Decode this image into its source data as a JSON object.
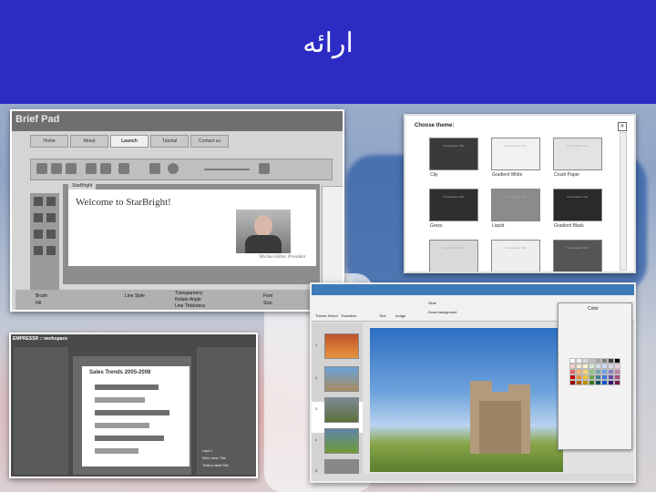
{
  "slide": {
    "title": "ارائه"
  },
  "shot1": {
    "logo": "Brief Pad",
    "nav": [
      "Home",
      "About",
      "Launch",
      "Tutorial",
      "Contact us"
    ],
    "active_nav": "Launch",
    "canvas_tab": "StarBright",
    "welcome": "Welcome to StarBright!",
    "caption": "Michael Hiller, President",
    "bottom_labels": [
      "Brush",
      "Fill",
      "Line Style",
      "Transparency",
      "Rotate Angle",
      "Line Thickness",
      "Font",
      "Size"
    ]
  },
  "shot2": {
    "title": "Choose theme:",
    "close": "✕",
    "themes": [
      {
        "name": "City",
        "color": "#3a3a3a"
      },
      {
        "name": "Gradient White",
        "color": "#f1f1f1"
      },
      {
        "name": "Crush Paper",
        "color": "#e3e3e3"
      },
      {
        "name": "Grass",
        "color": "#2f2f2f"
      },
      {
        "name": "Liquid",
        "color": "#8b8b8b"
      },
      {
        "name": "Gradient Black",
        "color": "#2a2a2a"
      },
      {
        "name": "",
        "color": "#d9d9d9"
      },
      {
        "name": "",
        "color": "#eeeeee"
      },
      {
        "name": "",
        "color": "#555555"
      }
    ],
    "theme_sample_text": "Presentation Title"
  },
  "shot3": {
    "app_title": "EMPRESSR :: workspace",
    "chart_title": "Sales Trends 2005-2008",
    "panel_rows": [
      "Layer 1",
      "Slide name: Title",
      "Textbox tablet Title"
    ]
  },
  "shot4": {
    "ribbon_labels": [
      "Theme Select",
      "Transition",
      "Text",
      "Image",
      "Slide",
      "Draw background"
    ],
    "thumb_numbers": [
      "1",
      "2",
      "3",
      "4",
      "5"
    ],
    "color_panel_title": "Color",
    "swatches": [
      "#ffffff",
      "#f2f2f2",
      "#d9d9d9",
      "#bfbfbf",
      "#a6a6a6",
      "#808080",
      "#404040",
      "#000000",
      "#f4cccc",
      "#fce5cd",
      "#fff2cc",
      "#d9ead3",
      "#d0e0e3",
      "#c9daf8",
      "#d9d2e9",
      "#ead1dc",
      "#e06666",
      "#f6b26b",
      "#ffd966",
      "#93c47d",
      "#76a5af",
      "#6d9eeb",
      "#8e7cc3",
      "#c27ba0",
      "#cc0000",
      "#e69138",
      "#f1c232",
      "#6aa84f",
      "#45818e",
      "#3c78d8",
      "#674ea7",
      "#a64d79",
      "#990000",
      "#b45f06",
      "#bf9000",
      "#38761d",
      "#134f5c",
      "#1155cc",
      "#351c75",
      "#741b47"
    ]
  }
}
